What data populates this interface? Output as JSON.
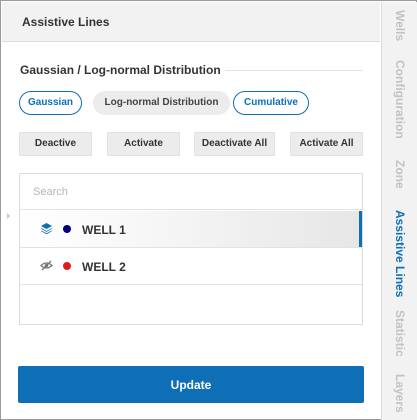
{
  "panel": {
    "title": "Assistive Lines"
  },
  "section": {
    "title": "Gaussian / Log-normal Distribution"
  },
  "distribution_options": [
    {
      "label": "Gaussian",
      "selected": true
    },
    {
      "label": "Log-normal Distribution",
      "selected": false
    },
    {
      "label": "Cumulative",
      "selected": true
    }
  ],
  "actions": [
    {
      "label": "Deactive"
    },
    {
      "label": "Activate"
    },
    {
      "label": "Deactivate All"
    },
    {
      "label": "Activate All"
    }
  ],
  "search": {
    "placeholder": "Search",
    "value": ""
  },
  "wells": [
    {
      "name": "WELL 1",
      "icon": "layers-icon",
      "color": "#000080",
      "selected": true
    },
    {
      "name": "WELL 2",
      "icon": "eye-off-icon",
      "color": "#e01b1b",
      "selected": false
    }
  ],
  "update_button": {
    "label": "Update"
  },
  "side_tabs": [
    {
      "label": "Wells",
      "active": false
    },
    {
      "label": "Configuration",
      "active": false
    },
    {
      "label": "Zone",
      "active": false
    },
    {
      "label": "Assistive Lines",
      "active": true
    },
    {
      "label": "Statistic",
      "active": false
    },
    {
      "label": "Layers",
      "active": false
    }
  ],
  "colors": {
    "accent": "#0e6fb7"
  }
}
